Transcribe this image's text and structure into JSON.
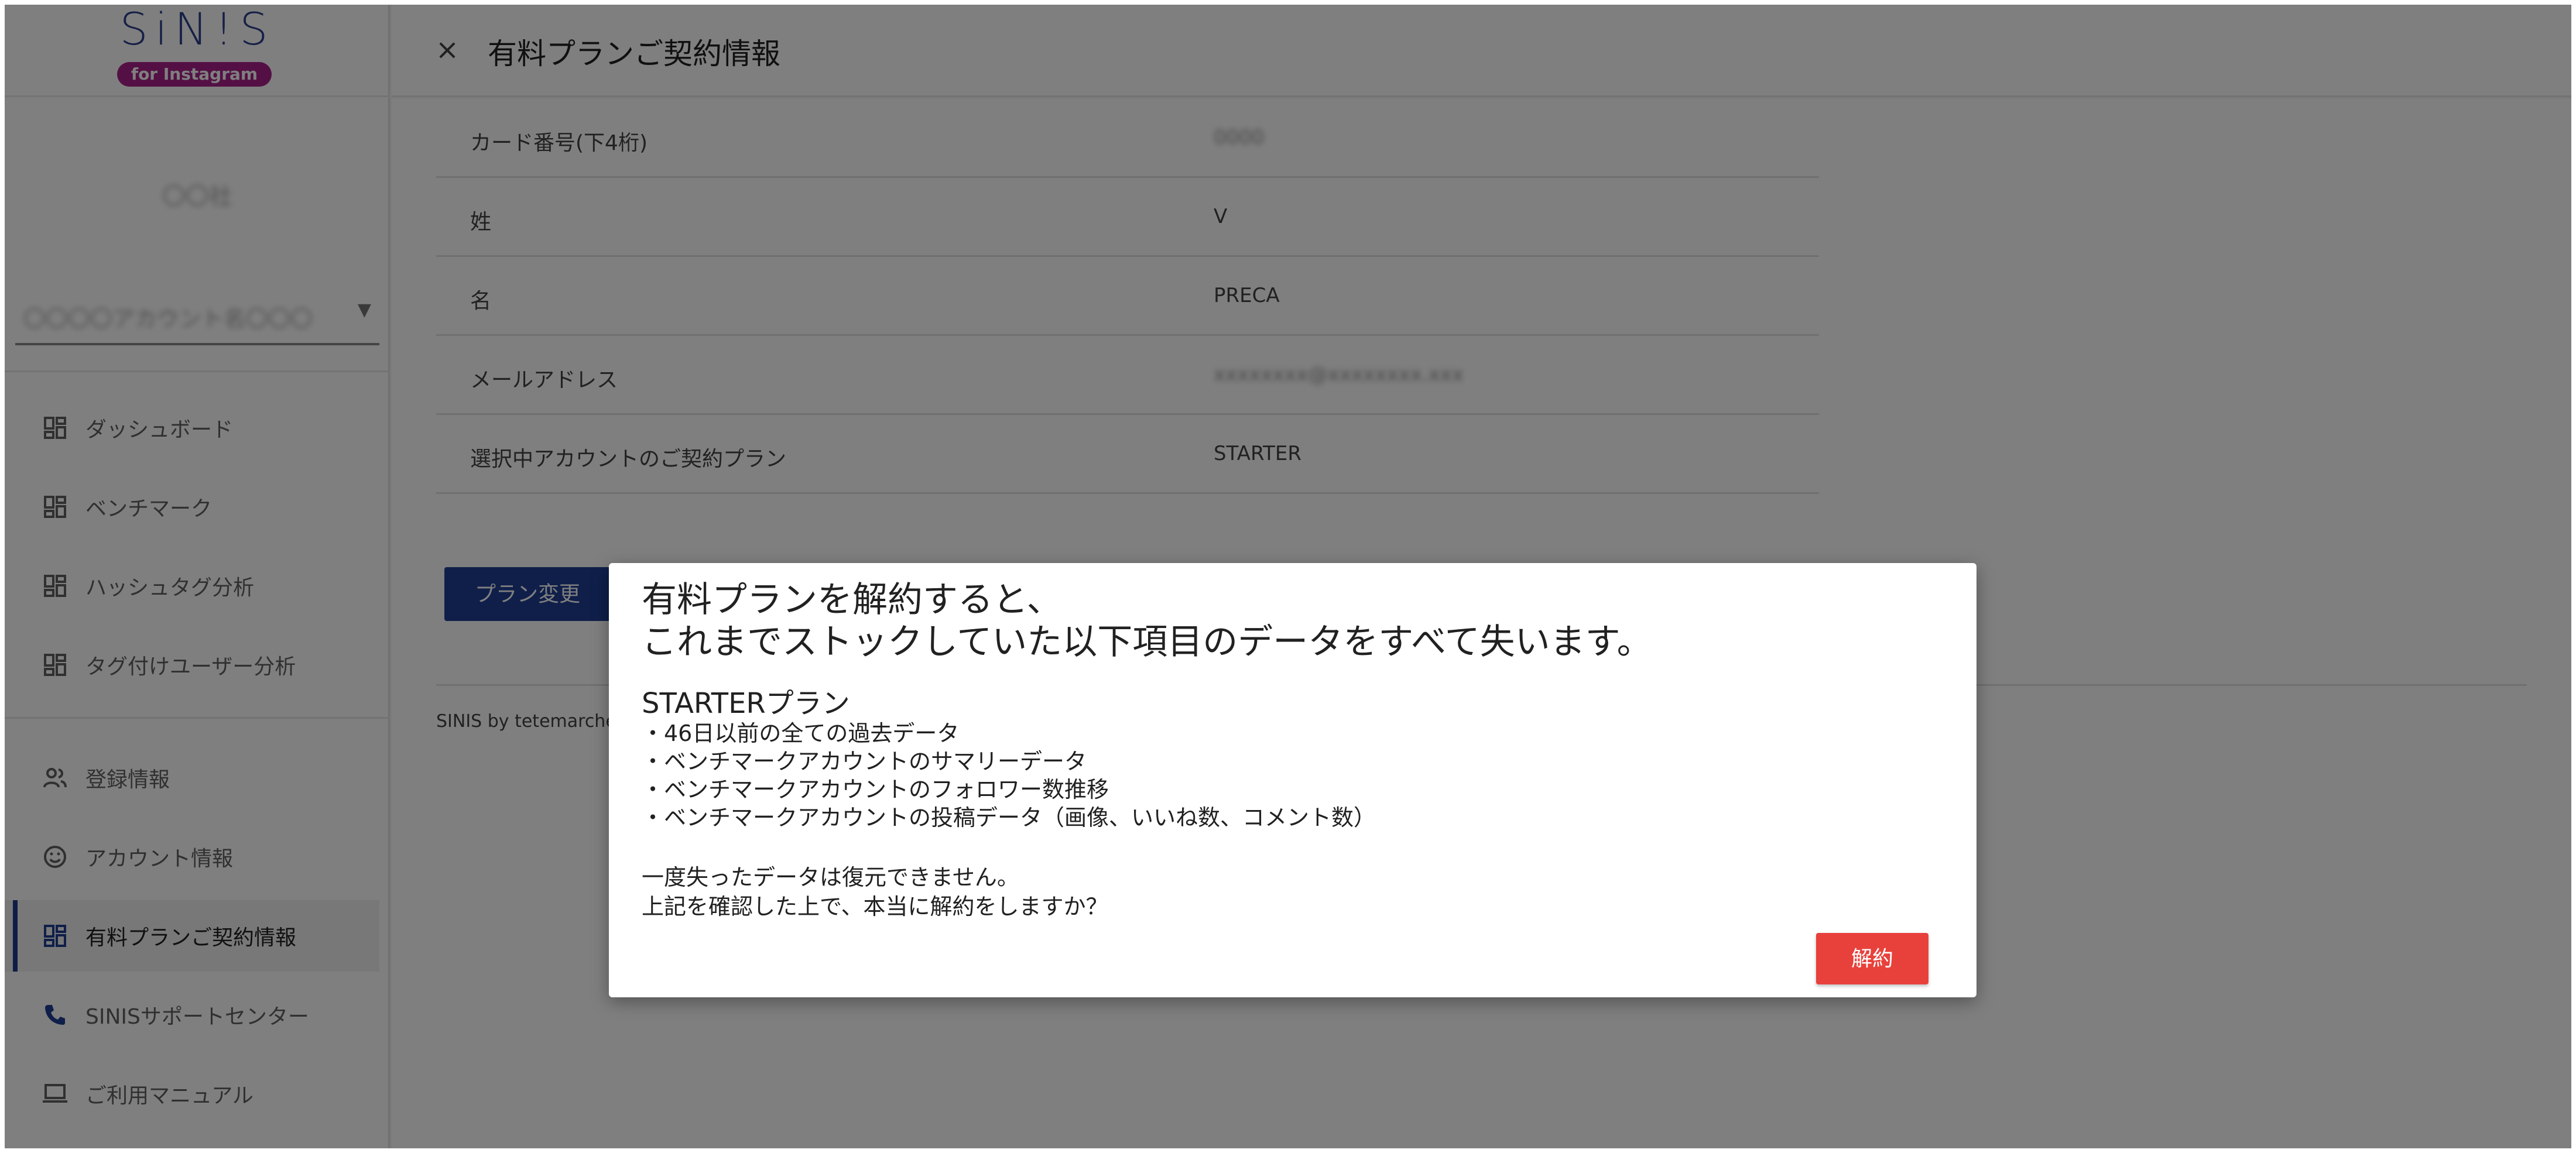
{
  "app": {
    "logo_text": "SiN!S",
    "logo_subtext": "for Instagram",
    "brand_color": "#a8208a",
    "primary_color": "#1f3f95",
    "danger_color": "#e8413c"
  },
  "sidebar": {
    "account_name": "〇〇社",
    "account_select_value": "〇〇〇〇アカウント名〇〇〇",
    "items": [
      {
        "label": "ダッシュボード",
        "icon": "dashboard-icon"
      },
      {
        "label": "ベンチマーク",
        "icon": "dashboard-icon"
      },
      {
        "label": "ハッシュタグ分析",
        "icon": "dashboard-icon"
      },
      {
        "label": "タグ付けユーザー分析",
        "icon": "dashboard-icon"
      },
      {
        "label": "登録情報",
        "icon": "people-icon"
      },
      {
        "label": "アカウント情報",
        "icon": "smiley-icon"
      },
      {
        "label": "有料プランご契約情報",
        "icon": "dashboard-icon",
        "active": true
      },
      {
        "label": "SINISサポートセンター",
        "icon": "phone-icon"
      },
      {
        "label": "ご利用マニュアル",
        "icon": "laptop-icon"
      }
    ]
  },
  "header": {
    "title": "有料プランご契約情報"
  },
  "info": {
    "rows": [
      {
        "label": "カード番号(下4桁)",
        "value": "0000"
      },
      {
        "label": "姓",
        "value": "V"
      },
      {
        "label": "名",
        "value": "PRECA"
      },
      {
        "label": "メールアドレス",
        "value": "xxxxxxxx@xxxxxxxx.xxx"
      },
      {
        "label": "選択中アカウントのご契約プラン",
        "value": "STARTER"
      }
    ],
    "plan_change_label": "プラン変更"
  },
  "footer": {
    "text": "SINIS by tetemarche"
  },
  "dialog": {
    "heading_line1": "有料プランを解約すると、",
    "heading_line2": "これまでストックしていた以下項目のデータをすべて失います。",
    "plan_name": "STARTERプラン",
    "items": [
      "・46日以前の全ての過去データ",
      "・ベンチマークアカウントのサマリーデータ",
      "・ベンチマークアカウントのフォロワー数推移",
      "・ベンチマークアカウントの投稿データ（画像、いいね数、コメント数）"
    ],
    "note_line1": "一度失ったデータは復元できません。",
    "note_line2": "上記を確認した上で、本当に解約をしますか？",
    "confirm_label": "解約"
  }
}
